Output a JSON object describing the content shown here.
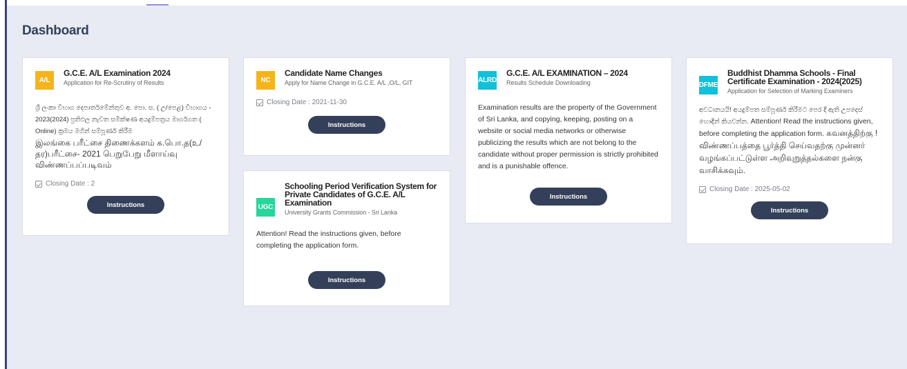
{
  "header": {
    "title": "Dashboard"
  },
  "colors": {
    "badge_yellow": "#f4b41a",
    "badge_cyan": "#12c1d9",
    "badge_green": "#27d69a",
    "primary_button": "#34405a",
    "accent_border": "#3d3f7c"
  },
  "cards": [
    {
      "badge": "A/L",
      "title": "G.C.E. A/L Examination 2024",
      "subtitle": "Application for Re-Scrutiny of Results",
      "body_si": "ශ්‍රී ලංකා විභාග දෙපාර්තමේන්තුව අ. පො. ස. ( උ/පෙළ) විභාගය - 2023(2024) ප්‍රතිඵල නැවත සමීක්ෂණ අයදුම්පත්‍රය මාර්ගගත ( Online) ක්‍රමය මගින් සම්පූර්ණ කිරීම",
      "body_ta": "இலங்கை பரீட்சை திணைக்களம் க.பொ.த(உ/தர)பரீட்சை- 2021 பெறுபேறு மீளாய்வு விண்ணப்பப்படிவம்",
      "closing": "Closing Date : 2",
      "button": "Instructions"
    },
    {
      "badge": "NC",
      "title": "Candidate Name Changes",
      "subtitle": "Apply for Name Change in G.C.E. A/L ,O/L, GIT",
      "closing": "Closing Date : 2021-11-30",
      "button": "Instructions"
    },
    {
      "badge": "UGC",
      "title": "Schooling Period Verification System for Private Candidates of G.C.E. A/L Examination",
      "subtitle": "University Grants Commission - Sri Lanka",
      "body": "Attention! Read the instructions given, before completing the application form.",
      "button": "Instructions"
    },
    {
      "badge": "ALRD",
      "title": "G.C.E. A/L EXAMINATION – 2024",
      "subtitle": "Results Schedule Downloading",
      "body": "Examination results are the property of the Government of Sri Lanka, and copying, keeping, posting on a website or social media networks or otherwise publicizing the results which are not belong to the candidate without proper permission is strictly prohibited and is a punishable offence.",
      "button": "Instructions"
    },
    {
      "badge": "DFME",
      "title": "Buddhist Dhamma Schools - Final Certificate Examination - 2024(2025)",
      "subtitle": "Application for Selection of Marking Examiners",
      "body_si": "අවධානයයි! අයදුම්පත සම්පූර්ණ කිරීමට පෙර දී ඇති උපදෙස් හොඳින් කියවන්න.",
      "body_en": " Attention! Read the instructions given, before completing the application form.",
      "body_ta": " கவனத்திற்கு ! விண்ணப்பத்தை பூர்த்தி செய்வதற்கு முன்னர் வழங்கப்பட்டுள்ள அறிவுறுத்தல்களை நன்கு வாசிக்கவும்.",
      "closing": "Closing Date : 2025-05-02",
      "button": "Instructions"
    }
  ]
}
